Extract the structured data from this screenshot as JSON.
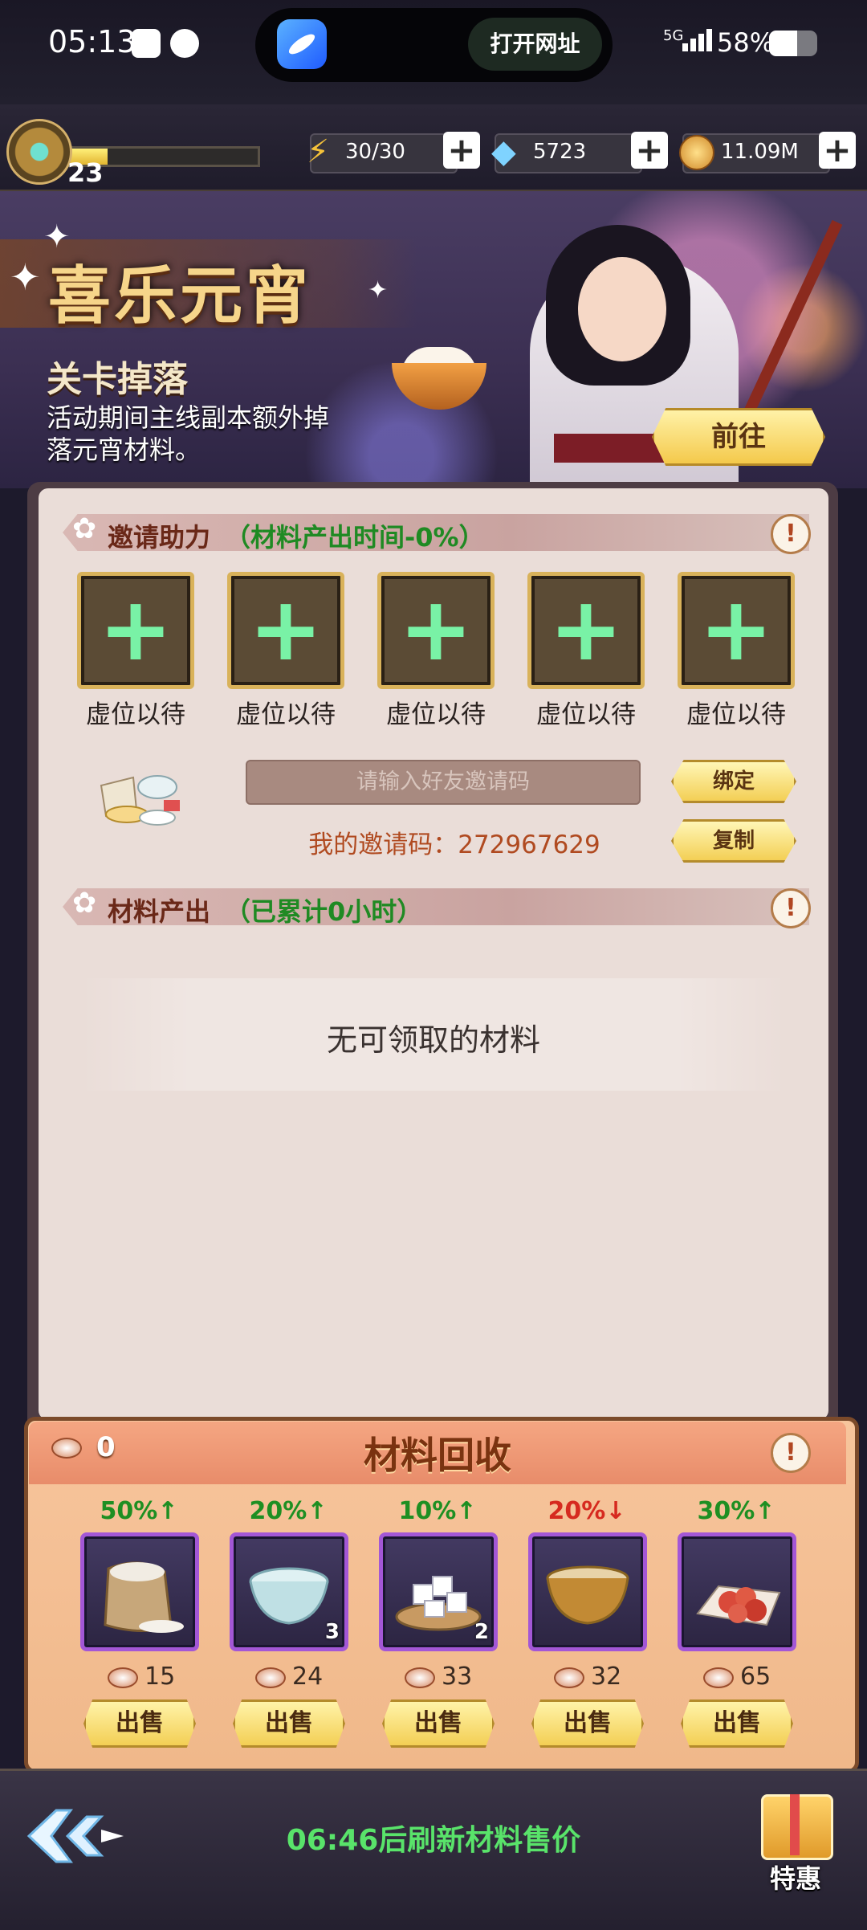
{
  "status_bar": {
    "time": "05:13",
    "open_url_label": "打开网址",
    "network": "5G",
    "battery": "58%",
    "battery_level": 0.58
  },
  "resources": {
    "level": "23",
    "xp_progress": 0.22,
    "energy": "30/30",
    "gems": "5723",
    "coins": "11.09M"
  },
  "banner": {
    "event_title": "喜乐元宵",
    "drop_title": "关卡掉落",
    "drop_desc": "活动期间主线副本额外掉落元宵材料。",
    "go_label": "前往"
  },
  "invite": {
    "title": "邀请助力",
    "note": "（材料产出时间-0%）",
    "slot_label": "虚位以待",
    "slots": [
      "虚位以待",
      "虚位以待",
      "虚位以待",
      "虚位以待",
      "虚位以待"
    ],
    "input_placeholder": "请输入好友邀请码",
    "bind_label": "绑定",
    "copy_label": "复制",
    "my_code": "我的邀请码：272967629"
  },
  "output": {
    "title": "材料产出",
    "note": "（已累计0小时）",
    "empty_msg": "无可领取的材料"
  },
  "recycle": {
    "title": "材料回收",
    "currency": "0",
    "sell_label": "出售",
    "items": [
      {
        "name": "flour",
        "pct": "50%↑",
        "trend": "up",
        "qty": "",
        "price": "15"
      },
      {
        "name": "water-bowl",
        "pct": "20%↑",
        "trend": "up",
        "qty": "3",
        "price": "24"
      },
      {
        "name": "sugar-cubes",
        "pct": "10%↑",
        "trend": "up",
        "qty": "2",
        "price": "33"
      },
      {
        "name": "golden-bowl",
        "pct": "20%↓",
        "trend": "down",
        "qty": "",
        "price": "32"
      },
      {
        "name": "red-filling",
        "pct": "30%↑",
        "trend": "up",
        "qty": "",
        "price": "65"
      }
    ]
  },
  "bottom": {
    "refresh": "06:46后刷新材料售价",
    "gift_label": "特惠"
  },
  "colors": {
    "accent_gold": "#f3cf55",
    "up_green": "#1e8f22",
    "down_red": "#d62a1f",
    "refresh_green": "#59e36a"
  }
}
